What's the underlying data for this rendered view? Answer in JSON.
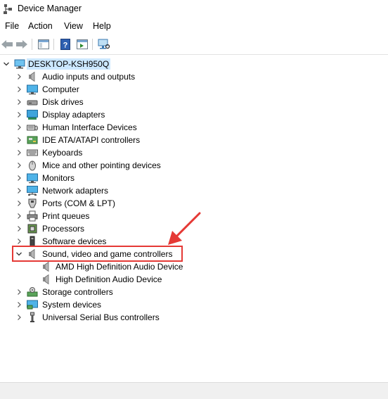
{
  "window": {
    "title": "Device Manager"
  },
  "menu": [
    "File",
    "Action",
    "View",
    "Help"
  ],
  "tree": {
    "root": "DESKTOP-KSH950Q",
    "categories": [
      {
        "label": "Audio inputs and outputs",
        "icon": "speaker-icon"
      },
      {
        "label": "Computer",
        "icon": "monitor-icon"
      },
      {
        "label": "Disk drives",
        "icon": "disk-drive-icon"
      },
      {
        "label": "Display adapters",
        "icon": "display-adapter-icon"
      },
      {
        "label": "Human Interface Devices",
        "icon": "hid-icon"
      },
      {
        "label": "IDE ATA/ATAPI controllers",
        "icon": "ide-controller-icon"
      },
      {
        "label": "Keyboards",
        "icon": "keyboard-icon"
      },
      {
        "label": "Mice and other pointing devices",
        "icon": "mouse-icon"
      },
      {
        "label": "Monitors",
        "icon": "monitor-icon"
      },
      {
        "label": "Network adapters",
        "icon": "network-adapter-icon"
      },
      {
        "label": "Ports (COM & LPT)",
        "icon": "port-icon"
      },
      {
        "label": "Print queues",
        "icon": "printer-icon"
      },
      {
        "label": "Processors",
        "icon": "processor-icon"
      },
      {
        "label": "Software devices",
        "icon": "software-device-icon"
      },
      {
        "label": "Sound, video and game controllers",
        "icon": "speaker-icon",
        "expanded": true,
        "children": [
          "AMD High Definition Audio Device",
          "High Definition Audio Device"
        ]
      },
      {
        "label": "Storage controllers",
        "icon": "storage-controller-icon"
      },
      {
        "label": "System devices",
        "icon": "system-device-icon"
      },
      {
        "label": "Universal Serial Bus controllers",
        "icon": "usb-icon"
      }
    ]
  },
  "colors": {
    "selection": "#cce8ff",
    "annotation": "#e53935"
  }
}
